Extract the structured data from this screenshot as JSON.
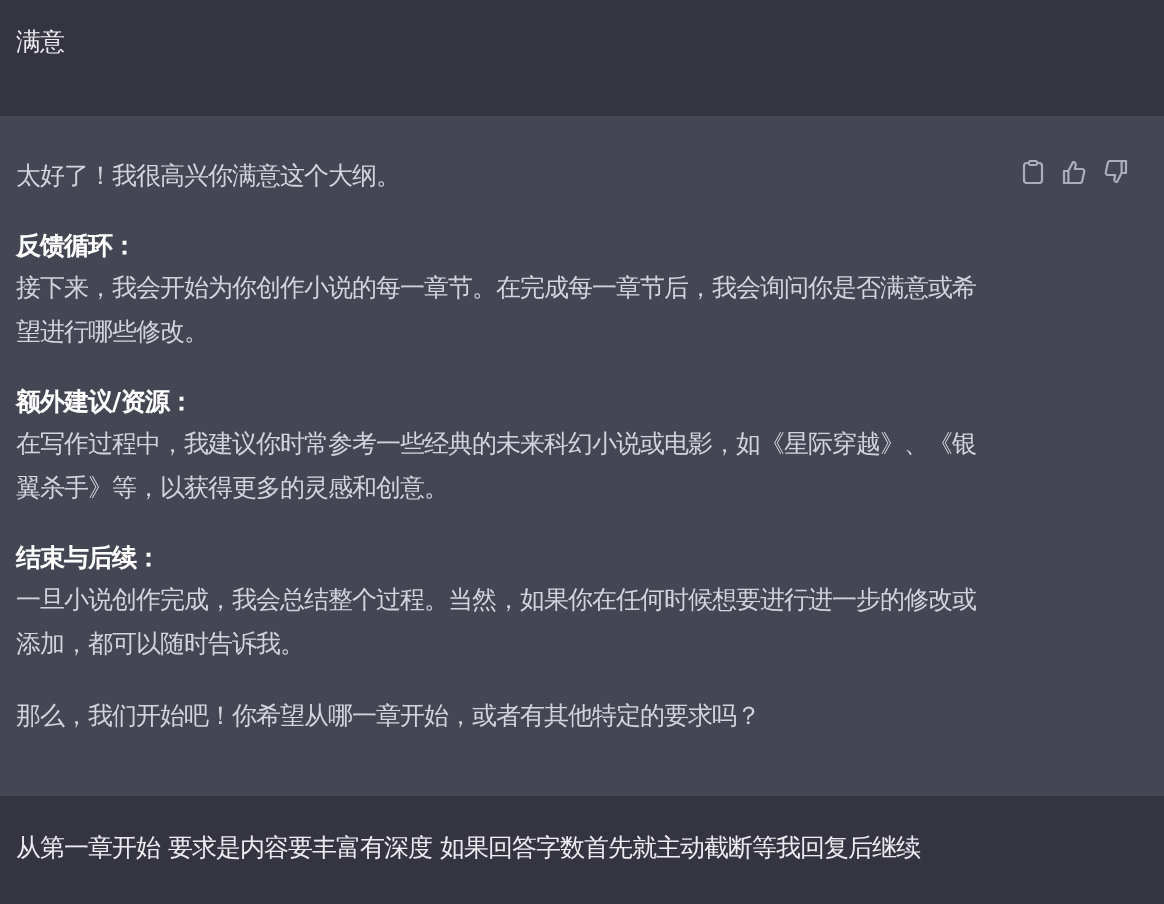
{
  "messages": [
    {
      "kind": "user",
      "text": "满意"
    },
    {
      "kind": "assistant",
      "intro": "太好了！我很高兴你满意这个大纲。",
      "sections": [
        {
          "heading": "反馈循环：",
          "body": "接下来，我会开始为你创作小说的每一章节。在完成每一章节后，我会询问你是否满意或希望进行哪些修改。"
        },
        {
          "heading": "额外建议/资源：",
          "body": "在写作过程中，我建议你时常参考一些经典的未来科幻小说或电影，如《星际穿越》、《银翼杀手》等，以获得更多的灵感和创意。"
        },
        {
          "heading": "结束与后续：",
          "body": "一旦小说创作完成，我会总结整个过程。当然，如果你在任何时候想要进行进一步的修改或添加，都可以随时告诉我。"
        }
      ],
      "closing": "那么，我们开始吧！你希望从哪一章开始，或者有其他特定的要求吗？"
    },
    {
      "kind": "user",
      "text": "从第一章开始 要求是内容要丰富有深度 如果回答字数首先就主动截断等我回复后继续"
    }
  ]
}
